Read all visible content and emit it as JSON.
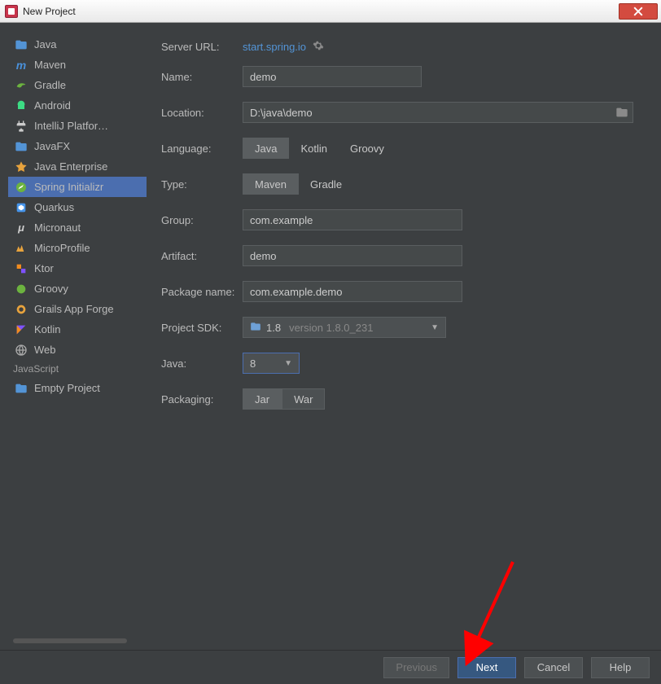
{
  "window": {
    "title": "New Project"
  },
  "sidebar": {
    "items": [
      {
        "label": "Java",
        "icon": "folder-blue"
      },
      {
        "label": "Maven",
        "icon": "maven"
      },
      {
        "label": "Gradle",
        "icon": "gradle"
      },
      {
        "label": "Android",
        "icon": "android"
      },
      {
        "label": "IntelliJ Platform Plugin",
        "icon": "plugin"
      },
      {
        "label": "JavaFX",
        "icon": "folder-blue"
      },
      {
        "label": "Java Enterprise",
        "icon": "jee"
      },
      {
        "label": "Spring Initializr",
        "icon": "spring",
        "selected": true
      },
      {
        "label": "Quarkus",
        "icon": "quarkus"
      },
      {
        "label": "Micronaut",
        "icon": "micronaut"
      },
      {
        "label": "MicroProfile",
        "icon": "microprofile"
      },
      {
        "label": "Ktor",
        "icon": "ktor"
      },
      {
        "label": "Groovy",
        "icon": "groovy"
      },
      {
        "label": "Grails App Forge",
        "icon": "grails"
      },
      {
        "label": "Kotlin",
        "icon": "kotlin"
      },
      {
        "label": "Web",
        "icon": "web"
      }
    ],
    "section": "JavaScript",
    "items2": [
      {
        "label": "Empty Project",
        "icon": "folder-blue"
      }
    ]
  },
  "form": {
    "server_url_label": "Server URL:",
    "server_url": "start.spring.io",
    "name_label": "Name:",
    "name": "demo",
    "location_label": "Location:",
    "location": "D:\\java\\demo",
    "language_label": "Language:",
    "language_opts": [
      "Java",
      "Kotlin",
      "Groovy"
    ],
    "language_sel": "Java",
    "type_label": "Type:",
    "type_opts": [
      "Maven",
      "Gradle"
    ],
    "type_sel": "Maven",
    "group_label": "Group:",
    "group": "com.example",
    "artifact_label": "Artifact:",
    "artifact": "demo",
    "package_label": "Package name:",
    "package": "com.example.demo",
    "sdk_label": "Project SDK:",
    "sdk_name": "1.8",
    "sdk_version": "version 1.8.0_231",
    "java_label": "Java:",
    "java": "8",
    "packaging_label": "Packaging:",
    "packaging_opts": [
      "Jar",
      "War"
    ],
    "packaging_sel": "Jar"
  },
  "footer": {
    "previous": "Previous",
    "next": "Next",
    "cancel": "Cancel",
    "help": "Help"
  }
}
